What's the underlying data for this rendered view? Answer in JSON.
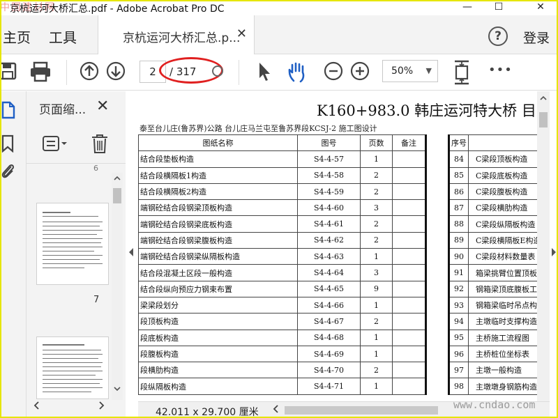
{
  "window": {
    "title": "京杭运河大桥汇总.pdf - Adobe Acrobat Pro DC",
    "watermark_logo": "中国建材网",
    "minimize": "—",
    "maximize": "☐",
    "close": "✕"
  },
  "menubar": {
    "home": "主页",
    "tools": "工具",
    "doc_tab": "京杭运河大桥汇总.p...",
    "doc_tab_close": "✕",
    "help": "?",
    "login": "登录"
  },
  "toolbar": {
    "page_current": "2",
    "page_total": "/ 317",
    "zoom": "50%",
    "zoom_arrow": "▼",
    "more": "•••",
    "annotation_color": "#e02020"
  },
  "thumbnails": {
    "title": "页面缩...",
    "close": "✕",
    "top_partial_number": "6",
    "page_7": "7"
  },
  "document": {
    "title": "K160+983.0  韩庄运河特大桥  目",
    "subtitle": "泰至台儿庄(鲁苏界)公路 台儿庄马兰屯至鲁苏界段KCSJ-2 施工图设计",
    "left_headers": [
      "图纸名称",
      "图号",
      "页数",
      "备注"
    ],
    "left_rows": [
      [
        "结合段垫板构造",
        "S4-4-57",
        "1",
        ""
      ],
      [
        "结合段横隔板1构造",
        "S4-4-58",
        "2",
        ""
      ],
      [
        "结合段横隔板2构造",
        "S4-4-59",
        "2",
        ""
      ],
      [
        "端钢砼结合段钢梁顶板构造",
        "S4-4-60",
        "3",
        ""
      ],
      [
        "端钢砼结合段钢梁底板构造",
        "S4-4-61",
        "2",
        ""
      ],
      [
        "端钢砼结合段钢梁腹板构造",
        "S4-4-62",
        "2",
        ""
      ],
      [
        "端钢砼结合段钢梁纵隔板构造",
        "S4-4-63",
        "1",
        ""
      ],
      [
        "结合段混凝土区段一般构造",
        "S4-4-64",
        "3",
        ""
      ],
      [
        "结合段纵向预应力钢束布置",
        "S4-4-65",
        "9",
        ""
      ],
      [
        "梁梁段划分",
        "S4-4-66",
        "1",
        ""
      ],
      [
        "段顶板构造",
        "S4-4-67",
        "2",
        ""
      ],
      [
        "段底板构造",
        "S4-4-68",
        "1",
        ""
      ],
      [
        "段腹板构造",
        "S4-4-69",
        "1",
        ""
      ],
      [
        "段横肋构造",
        "S4-4-70",
        "2",
        ""
      ],
      [
        "段纵隔板构造",
        "S4-4-71",
        "1",
        ""
      ]
    ],
    "right_header": "序号",
    "right_rows": [
      [
        "84",
        "C梁段顶板构造"
      ],
      [
        "85",
        "C梁段底板构造"
      ],
      [
        "86",
        "C梁段腹板构造"
      ],
      [
        "87",
        "C梁段横肋构造"
      ],
      [
        "88",
        "C梁段纵隔板构造"
      ],
      [
        "89",
        "C梁段横隔板E构造"
      ],
      [
        "90",
        "C梁段材料数量表"
      ],
      [
        "91",
        "箱梁挑臂位置顶板"
      ],
      [
        "92",
        "钢箱梁顶底腹板工"
      ],
      [
        "93",
        "钢箱梁临时吊点构"
      ],
      [
        "94",
        "主墩临时支撑构造"
      ],
      [
        "95",
        "主桥施工流程图"
      ],
      [
        "96",
        "主桥桩位坐标表"
      ],
      [
        "97",
        "主墩一般构造"
      ],
      [
        "98",
        "主墩墩身钢筋构造"
      ]
    ]
  },
  "statusbar": {
    "page_size": "42.011 x 29.700 厘米",
    "watermark": "www.cndao.com"
  }
}
